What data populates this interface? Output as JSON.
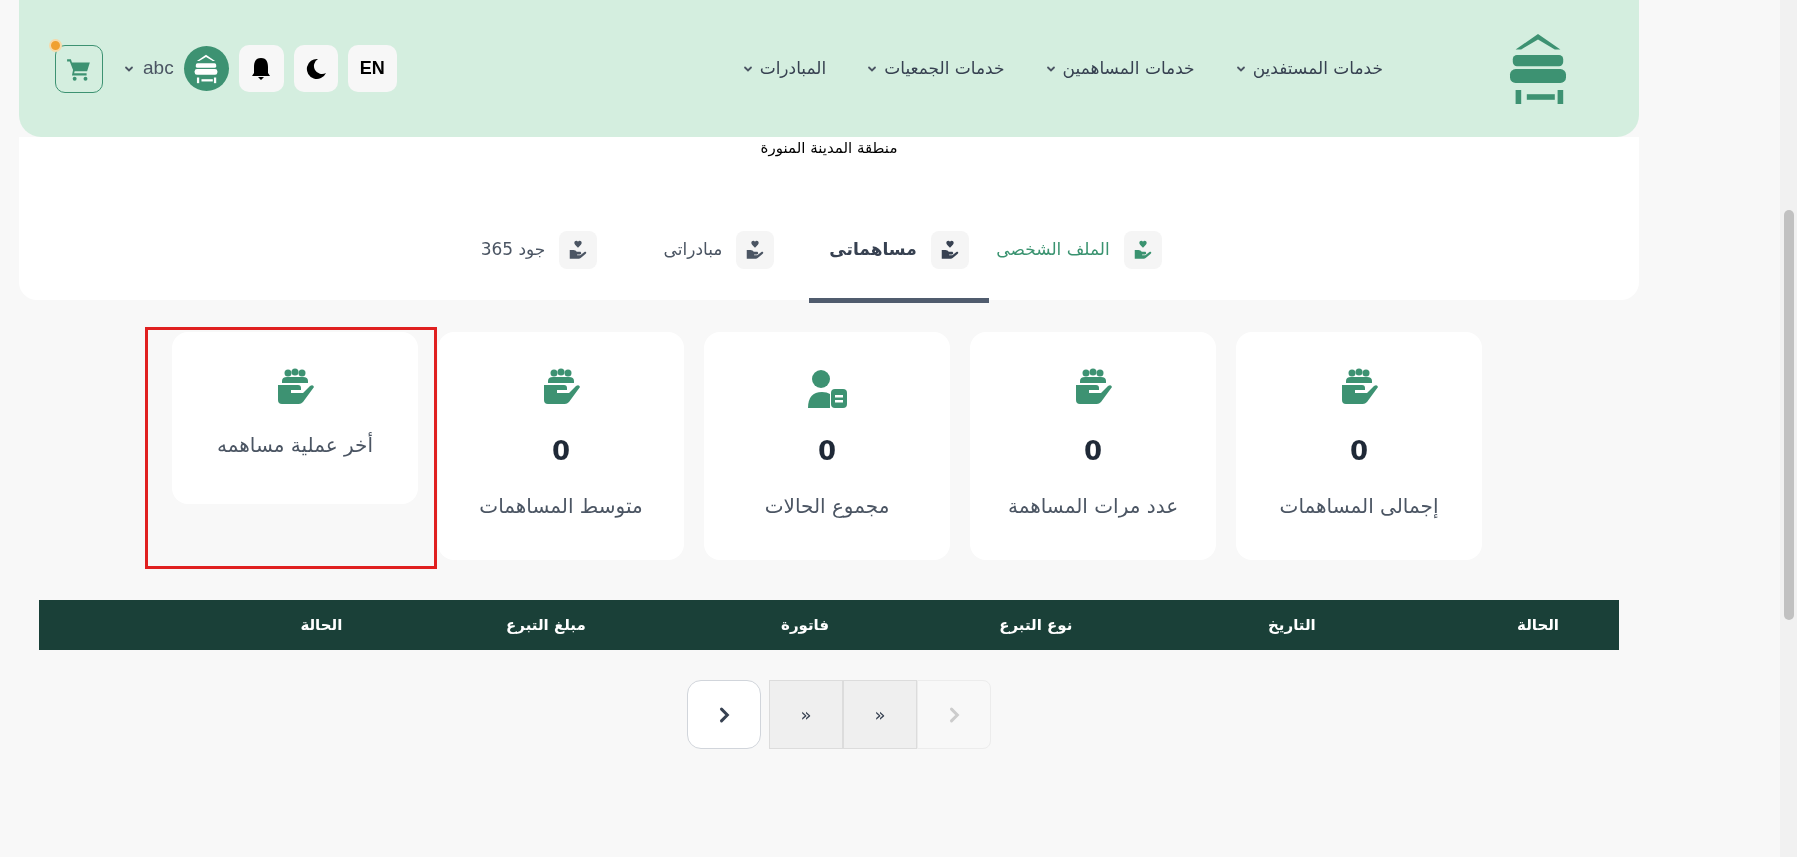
{
  "header": {
    "nav": [
      {
        "label": "خدمات المستفدين"
      },
      {
        "label": "خدمات المساهمين"
      },
      {
        "label": "خدمات الجمعيات"
      },
      {
        "label": "المبادرات"
      }
    ],
    "language": "EN",
    "user": "abc",
    "cart_badge": true
  },
  "region": "منطقة المدينة المنورة",
  "tabs": [
    {
      "label": "الملف الشخصى",
      "selected": false,
      "color": "#3a9370"
    },
    {
      "label": "مساهماتى",
      "selected": true,
      "color": "#374151"
    },
    {
      "label": "مبادراتى",
      "selected": false,
      "color": "#4b5563"
    },
    {
      "label": "جود 365",
      "selected": false,
      "color": "#4b5563"
    }
  ],
  "cards": [
    {
      "kind": "group",
      "value": "0",
      "label": "إجمالى المساهمات",
      "highlighted": false
    },
    {
      "kind": "group",
      "value": "0",
      "label": "عدد مرات المساهمة",
      "highlighted": false
    },
    {
      "kind": "person",
      "value": "0",
      "label": "مجموع الحالات",
      "highlighted": false
    },
    {
      "kind": "group",
      "value": "0",
      "label": "متوسط المساهمات",
      "highlighted": false
    },
    {
      "kind": "group",
      "label": "أخر عملية مساهمه",
      "highlighted": true
    }
  ],
  "table": {
    "columns": [
      "الحالة",
      "التاريخ",
      "نوع التبرع",
      "فاتورة",
      "مبلغ التبرع",
      "الحالة"
    ]
  },
  "pagination": [
    {
      "kind": "icon",
      "disabled": true
    },
    {
      "kind": "text",
      "label": "«",
      "disabled": false
    },
    {
      "kind": "text",
      "label": "«",
      "disabled": false
    },
    {
      "kind": "icon",
      "disabled": false
    }
  ]
}
